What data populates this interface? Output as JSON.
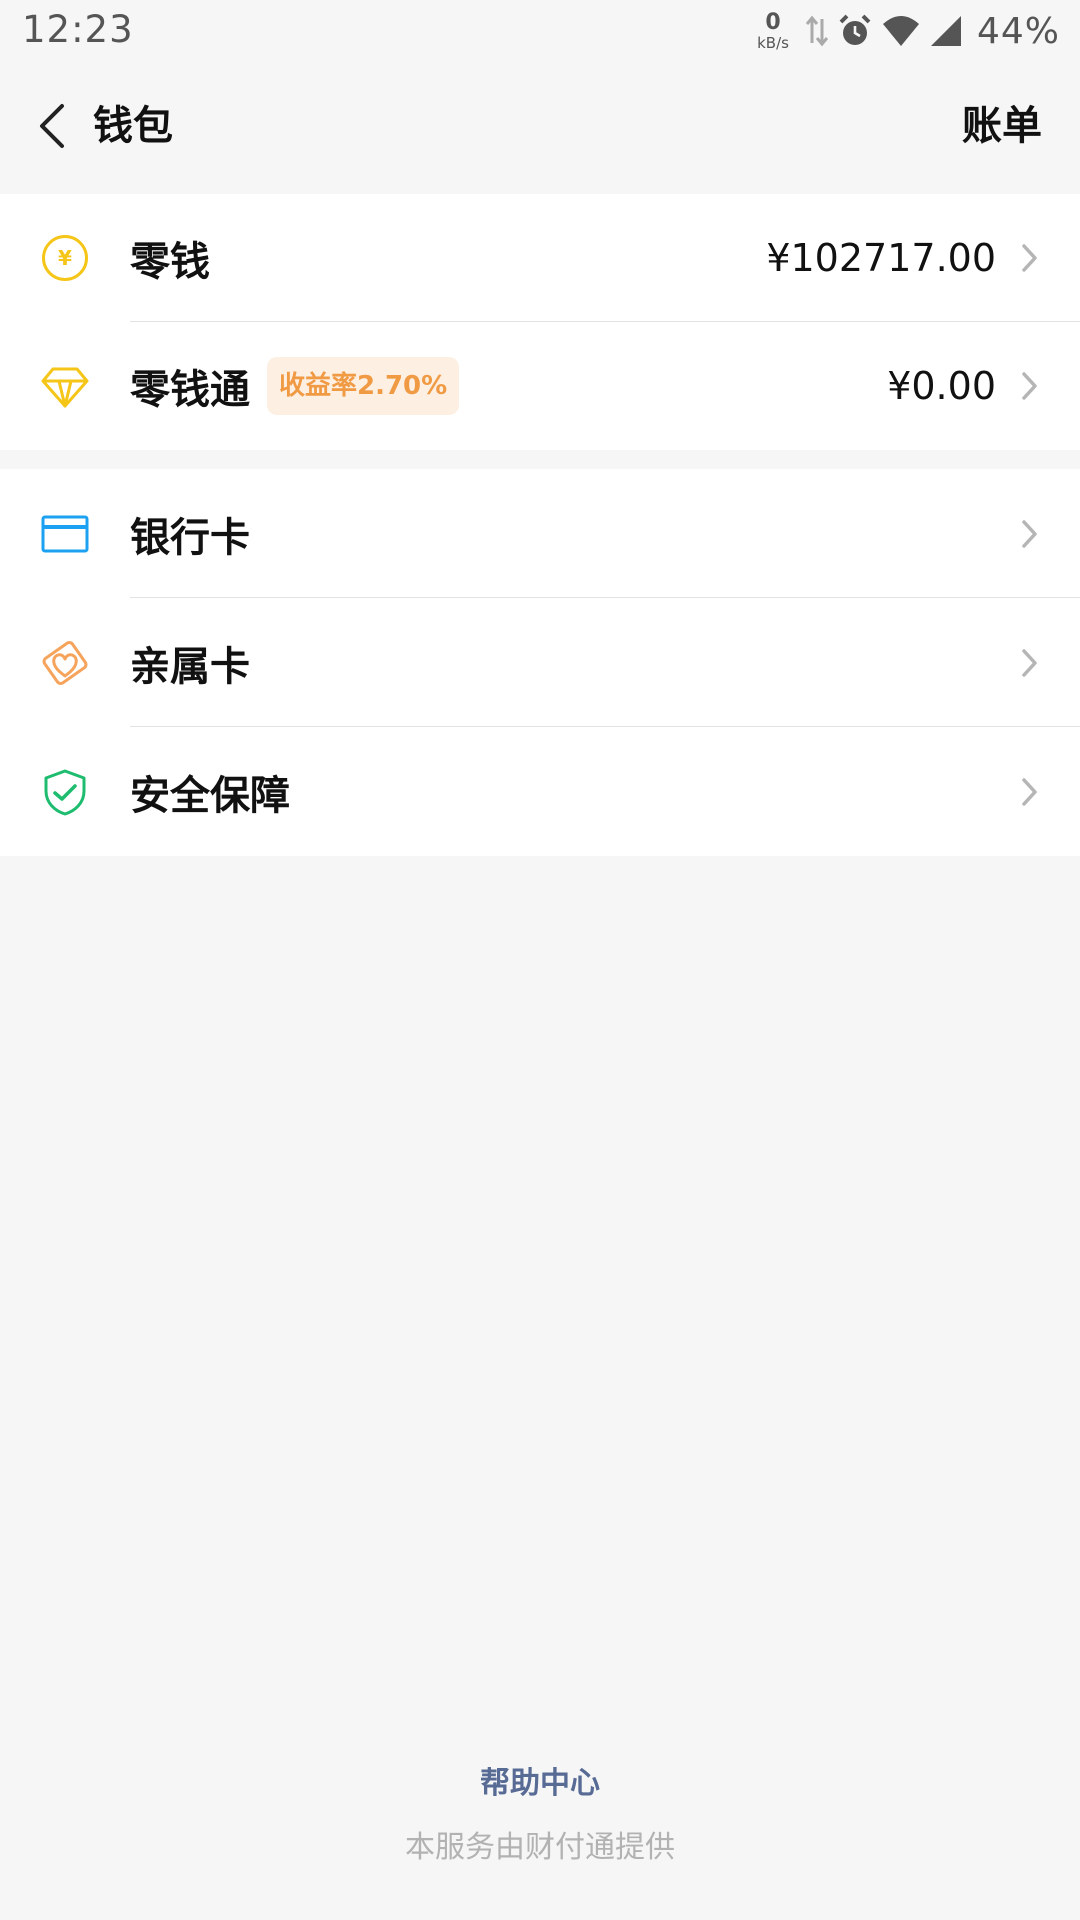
{
  "status_bar": {
    "time": "12:23",
    "net_speed_value": "0",
    "net_speed_unit": "kB/s",
    "battery": "44%"
  },
  "header": {
    "title": "钱包",
    "bill_label": "账单"
  },
  "groups": [
    {
      "items": [
        {
          "label": "零钱",
          "value": "¥102717.00",
          "icon": "yuan-coin-icon"
        },
        {
          "label": "零钱通",
          "badge": "收益率2.70%",
          "value": "¥0.00",
          "icon": "diamond-icon"
        }
      ]
    },
    {
      "items": [
        {
          "label": "银行卡",
          "icon": "bank-card-icon"
        },
        {
          "label": "亲属卡",
          "icon": "family-card-icon"
        },
        {
          "label": "安全保障",
          "icon": "shield-check-icon"
        }
      ]
    }
  ],
  "footer": {
    "help_center": "帮助中心",
    "provider": "本服务由财付通提供"
  },
  "colors": {
    "background": "#f6f6f6",
    "link_blue": "#576b95",
    "coin_yellow": "#f5c518",
    "badge_orange": "#f09a44",
    "card_blue": "#1ba0f2",
    "family_orange": "#f6a35b",
    "shield_green": "#1ebc6e"
  }
}
